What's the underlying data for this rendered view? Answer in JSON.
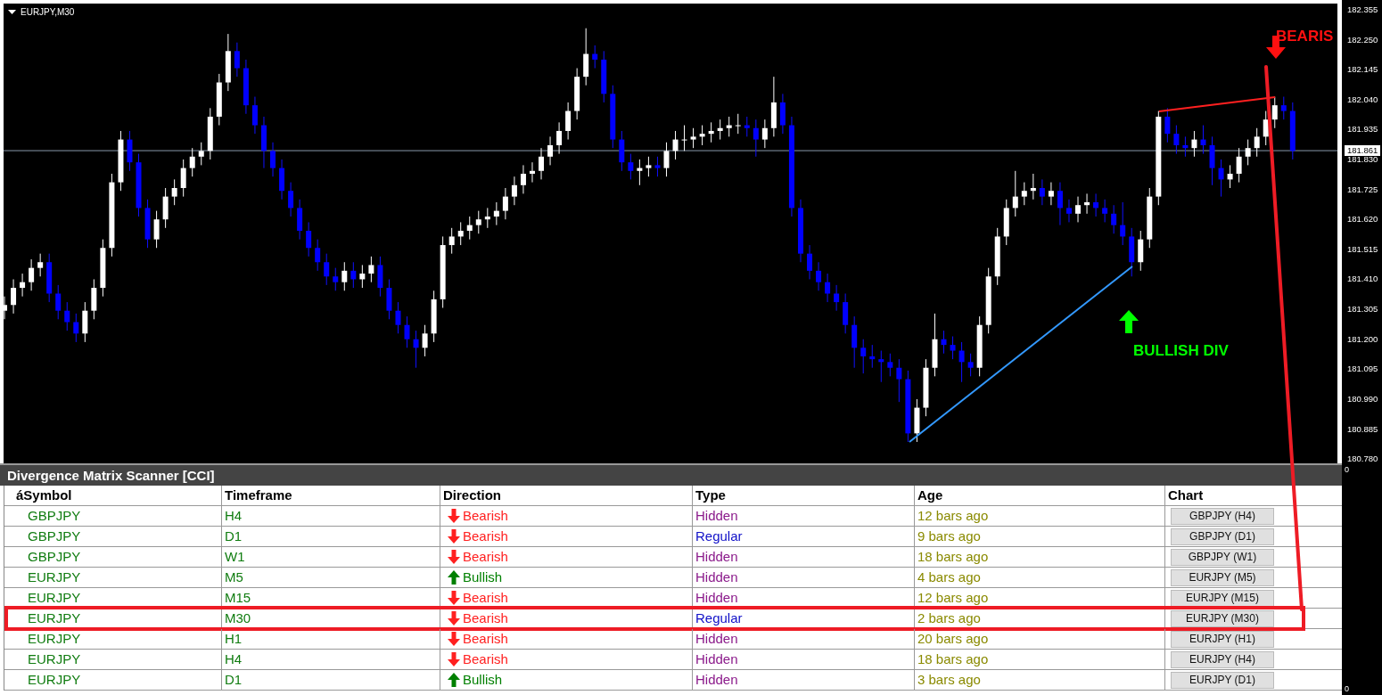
{
  "chart": {
    "title": "EURJPY,M30",
    "chart_data": {
      "type": "candlestick",
      "ylim": [
        180.765,
        182.389
      ],
      "yticks": [
        {
          "value": 182.355,
          "label": "182.355"
        },
        {
          "value": 182.25,
          "label": "182.250"
        },
        {
          "value": 182.145,
          "label": "182.145"
        },
        {
          "value": 182.04,
          "label": "182.040"
        },
        {
          "value": 181.935,
          "label": "181.935"
        },
        {
          "value": 181.83,
          "label": "181.830"
        },
        {
          "value": 181.725,
          "label": "181.725"
        },
        {
          "value": 181.62,
          "label": "181.620"
        },
        {
          "value": 181.515,
          "label": "181.515"
        },
        {
          "value": 181.41,
          "label": "181.410"
        },
        {
          "value": 181.305,
          "label": "181.305"
        },
        {
          "value": 181.2,
          "label": "181.200"
        },
        {
          "value": 181.095,
          "label": "181.095"
        },
        {
          "value": 180.99,
          "label": "180.990"
        },
        {
          "value": 180.885,
          "label": "180.885"
        },
        {
          "value": 180.78,
          "label": "180.780"
        }
      ],
      "ref_lines": [
        {
          "axis": "y",
          "value": 181.861
        }
      ],
      "categories": [
        null,
        null,
        null,
        null,
        null,
        null,
        null,
        null,
        null,
        null,
        null,
        null,
        null,
        null,
        null,
        null,
        null,
        null,
        null,
        null,
        null,
        null,
        null,
        null,
        null,
        null,
        null,
        null,
        null,
        null,
        null,
        null,
        null,
        null,
        null,
        null,
        null,
        null,
        null,
        null,
        null,
        null,
        null,
        null,
        null,
        null,
        null,
        null,
        null,
        null,
        null,
        null,
        null,
        null,
        null,
        null,
        null,
        null,
        null,
        null,
        null,
        null,
        null,
        null,
        null,
        null,
        null,
        null,
        null,
        null,
        null,
        null,
        null,
        null,
        null,
        null,
        null,
        null,
        null,
        null,
        null,
        null,
        null,
        null,
        null,
        null,
        null,
        null,
        null,
        null,
        null,
        null,
        null,
        null,
        null,
        null,
        null,
        null,
        null,
        null,
        null,
        null,
        null,
        null,
        null,
        null,
        null,
        null,
        null,
        null,
        null,
        null,
        null,
        null,
        null,
        null,
        null,
        null,
        null,
        null,
        null,
        null,
        null,
        null,
        null,
        null,
        null,
        null,
        null,
        null,
        null,
        null,
        null,
        null,
        null,
        null,
        null,
        null,
        null,
        null,
        null,
        null,
        null,
        null,
        null,
        null,
        null,
        null,
        null,
        null
      ],
      "ohlc": [
        [
          181.3,
          181.35,
          181.27,
          181.32
        ],
        [
          181.32,
          181.41,
          181.29,
          181.38
        ],
        [
          181.38,
          181.43,
          181.35,
          181.4
        ],
        [
          181.4,
          181.48,
          181.37,
          181.45
        ],
        [
          181.45,
          181.5,
          181.42,
          181.47
        ],
        [
          181.47,
          181.5,
          181.33,
          181.36
        ],
        [
          181.36,
          181.39,
          181.27,
          181.3
        ],
        [
          181.3,
          181.33,
          181.23,
          181.26
        ],
        [
          181.26,
          181.29,
          181.19,
          181.22
        ],
        [
          181.22,
          181.33,
          181.19,
          181.3
        ],
        [
          181.3,
          181.41,
          181.27,
          181.38
        ],
        [
          181.38,
          181.55,
          181.35,
          181.52
        ],
        [
          181.52,
          181.78,
          181.49,
          181.75
        ],
        [
          181.75,
          181.93,
          181.72,
          181.9
        ],
        [
          181.9,
          181.93,
          181.79,
          181.82
        ],
        [
          181.82,
          181.85,
          181.63,
          181.66
        ],
        [
          181.66,
          181.69,
          181.52,
          181.55
        ],
        [
          181.55,
          181.65,
          181.52,
          181.62
        ],
        [
          181.62,
          181.73,
          181.59,
          181.7
        ],
        [
          181.7,
          181.76,
          181.67,
          181.73
        ],
        [
          181.73,
          181.83,
          181.7,
          181.8
        ],
        [
          181.8,
          181.87,
          181.77,
          181.84
        ],
        [
          181.84,
          181.89,
          181.81,
          181.86
        ],
        [
          181.86,
          182.01,
          181.83,
          181.98
        ],
        [
          181.98,
          182.13,
          181.95,
          182.1
        ],
        [
          182.1,
          182.27,
          182.07,
          182.21
        ],
        [
          182.21,
          182.24,
          182.12,
          182.15
        ],
        [
          182.15,
          182.18,
          181.99,
          182.02
        ],
        [
          182.02,
          182.05,
          181.92,
          181.95
        ],
        [
          181.95,
          181.98,
          181.8,
          181.86
        ],
        [
          181.86,
          181.89,
          181.77,
          181.8
        ],
        [
          181.8,
          181.83,
          181.69,
          181.72
        ],
        [
          181.72,
          181.75,
          181.63,
          181.66
        ],
        [
          181.66,
          181.69,
          181.55,
          181.58
        ],
        [
          181.58,
          181.61,
          181.49,
          181.52
        ],
        [
          181.52,
          181.55,
          181.44,
          181.47
        ],
        [
          181.47,
          181.5,
          181.39,
          181.42
        ],
        [
          181.42,
          181.45,
          181.37,
          181.4
        ],
        [
          181.4,
          181.47,
          181.37,
          181.44
        ],
        [
          181.44,
          181.47,
          181.38,
          181.41
        ],
        [
          181.41,
          181.46,
          181.38,
          181.43
        ],
        [
          181.43,
          181.49,
          181.4,
          181.46
        ],
        [
          181.46,
          181.49,
          181.35,
          181.38
        ],
        [
          181.38,
          181.41,
          181.27,
          181.3
        ],
        [
          181.3,
          181.33,
          181.22,
          181.25
        ],
        [
          181.25,
          181.28,
          181.17,
          181.2
        ],
        [
          181.2,
          181.23,
          181.1,
          181.17
        ],
        [
          181.17,
          181.25,
          181.14,
          181.22
        ],
        [
          181.22,
          181.37,
          181.19,
          181.34
        ],
        [
          181.34,
          181.56,
          181.31,
          181.53
        ],
        [
          181.53,
          181.59,
          181.5,
          181.56
        ],
        [
          181.56,
          181.61,
          181.53,
          181.58
        ],
        [
          181.58,
          181.63,
          181.55,
          181.6
        ],
        [
          181.6,
          181.65,
          181.57,
          181.62
        ],
        [
          181.62,
          181.66,
          181.59,
          181.63
        ],
        [
          181.63,
          181.68,
          181.6,
          181.65
        ],
        [
          181.65,
          181.73,
          181.62,
          181.7
        ],
        [
          181.7,
          181.77,
          181.67,
          181.74
        ],
        [
          181.74,
          181.81,
          181.71,
          181.78
        ],
        [
          181.78,
          181.82,
          181.75,
          181.79
        ],
        [
          181.79,
          181.87,
          181.76,
          181.84
        ],
        [
          181.84,
          181.91,
          181.81,
          181.88
        ],
        [
          181.88,
          181.96,
          181.85,
          181.93
        ],
        [
          181.93,
          182.03,
          181.9,
          182.0
        ],
        [
          182.0,
          182.15,
          181.97,
          182.12
        ],
        [
          182.12,
          182.29,
          182.09,
          182.2
        ],
        [
          182.2,
          182.23,
          182.15,
          182.18
        ],
        [
          182.18,
          182.21,
          182.03,
          182.06
        ],
        [
          182.06,
          182.09,
          181.87,
          181.9
        ],
        [
          181.9,
          181.93,
          181.79,
          181.82
        ],
        [
          181.82,
          181.85,
          181.76,
          181.79
        ],
        [
          181.79,
          181.83,
          181.74,
          181.8
        ],
        [
          181.8,
          181.84,
          181.77,
          181.81
        ],
        [
          181.81,
          181.84,
          181.77,
          181.8
        ],
        [
          181.8,
          181.89,
          181.77,
          181.86
        ],
        [
          181.86,
          181.93,
          181.83,
          181.9
        ],
        [
          181.9,
          181.95,
          181.86,
          181.9
        ],
        [
          181.9,
          181.94,
          181.87,
          181.91
        ],
        [
          181.91,
          181.95,
          181.88,
          181.92
        ],
        [
          181.92,
          181.96,
          181.89,
          181.93
        ],
        [
          181.93,
          181.97,
          181.9,
          181.94
        ],
        [
          181.94,
          181.98,
          181.91,
          181.95
        ],
        [
          181.95,
          181.99,
          181.92,
          181.95
        ],
        [
          181.95,
          181.98,
          181.91,
          181.94
        ],
        [
          181.94,
          181.97,
          181.84,
          181.9
        ],
        [
          181.9,
          181.97,
          181.87,
          181.94
        ],
        [
          181.94,
          182.12,
          181.91,
          182.03
        ],
        [
          182.03,
          182.06,
          181.92,
          181.95
        ],
        [
          181.95,
          181.98,
          181.63,
          181.66
        ],
        [
          181.66,
          181.69,
          181.47,
          181.5
        ],
        [
          181.5,
          181.53,
          181.41,
          181.44
        ],
        [
          181.44,
          181.47,
          181.37,
          181.4
        ],
        [
          181.4,
          181.43,
          181.33,
          181.36
        ],
        [
          181.36,
          181.39,
          181.3,
          181.33
        ],
        [
          181.33,
          181.36,
          181.22,
          181.25
        ],
        [
          181.25,
          181.28,
          181.1,
          181.17
        ],
        [
          181.17,
          181.2,
          181.08,
          181.14
        ],
        [
          181.14,
          181.18,
          181.1,
          181.13
        ],
        [
          181.13,
          181.16,
          181.05,
          181.12
        ],
        [
          181.12,
          181.15,
          181.07,
          181.1
        ],
        [
          181.1,
          181.13,
          180.98,
          181.06
        ],
        [
          181.06,
          181.09,
          180.84,
          180.87
        ],
        [
          180.87,
          180.99,
          180.84,
          180.96
        ],
        [
          180.96,
          181.13,
          180.93,
          181.1
        ],
        [
          181.1,
          181.29,
          181.07,
          181.2
        ],
        [
          181.2,
          181.23,
          181.15,
          181.18
        ],
        [
          181.18,
          181.21,
          181.13,
          181.16
        ],
        [
          181.16,
          181.19,
          181.05,
          181.12
        ],
        [
          181.12,
          181.15,
          181.07,
          181.1
        ],
        [
          181.1,
          181.28,
          181.07,
          181.25
        ],
        [
          181.25,
          181.45,
          181.22,
          181.42
        ],
        [
          181.42,
          181.59,
          181.39,
          181.56
        ],
        [
          181.56,
          181.69,
          181.53,
          181.66
        ],
        [
          181.66,
          181.79,
          181.63,
          181.7
        ],
        [
          181.7,
          181.75,
          181.67,
          181.72
        ],
        [
          181.72,
          181.78,
          181.69,
          181.73
        ],
        [
          181.73,
          181.76,
          181.67,
          181.7
        ],
        [
          181.7,
          181.75,
          181.67,
          181.72
        ],
        [
          181.72,
          181.75,
          181.6,
          181.66
        ],
        [
          181.66,
          181.69,
          181.61,
          181.64
        ],
        [
          181.64,
          181.7,
          181.61,
          181.67
        ],
        [
          181.67,
          181.71,
          181.64,
          181.68
        ],
        [
          181.68,
          181.71,
          181.63,
          181.66
        ],
        [
          181.66,
          181.69,
          181.61,
          181.64
        ],
        [
          181.64,
          181.67,
          181.57,
          181.6
        ],
        [
          181.6,
          181.68,
          181.53,
          181.56
        ],
        [
          181.56,
          181.59,
          181.42,
          181.47
        ],
        [
          181.47,
          181.58,
          181.44,
          181.55
        ],
        [
          181.55,
          181.73,
          181.52,
          181.7
        ],
        [
          181.7,
          182.0,
          181.67,
          181.98
        ],
        [
          181.98,
          182.01,
          181.89,
          181.92
        ],
        [
          181.92,
          181.95,
          181.85,
          181.88
        ],
        [
          181.88,
          181.91,
          181.84,
          181.87
        ],
        [
          181.87,
          181.93,
          181.84,
          181.9
        ],
        [
          181.9,
          181.95,
          181.85,
          181.88
        ],
        [
          181.88,
          181.91,
          181.74,
          181.8
        ],
        [
          181.8,
          181.83,
          181.7,
          181.76
        ],
        [
          181.76,
          181.81,
          181.73,
          181.78
        ],
        [
          181.78,
          181.87,
          181.75,
          181.84
        ],
        [
          181.84,
          181.9,
          181.81,
          181.87
        ],
        [
          181.87,
          181.94,
          181.84,
          181.91
        ],
        [
          181.91,
          182.0,
          181.88,
          181.97
        ],
        [
          181.97,
          182.05,
          181.94,
          182.02
        ],
        [
          182.02,
          182.05,
          181.97,
          182.0
        ],
        [
          182.0,
          182.03,
          181.83,
          181.86
        ],
        null,
        null,
        null,
        null,
        null
      ]
    },
    "current_price": "181.861",
    "annotations": [
      {
        "kind": "bullish",
        "label": "BULLISH DIV"
      },
      {
        "kind": "bearish",
        "label": "BEARIS"
      }
    ]
  },
  "scanner": {
    "title": "Divergence Matrix Scanner [CCI]",
    "columns": [
      "áSymbol",
      "Timeframe",
      "Direction",
      "Type",
      "Age",
      "Chart"
    ],
    "rows": [
      {
        "symbol": "GBPJPY",
        "timeframe": "H4",
        "direction": {
          "kind": "bearish",
          "label": "Bearish"
        },
        "type": {
          "kind": "hidden",
          "label": "Hidden"
        },
        "age": "12 bars ago",
        "chart_button": "GBPJPY (H4)",
        "outlined": false
      },
      {
        "symbol": "GBPJPY",
        "timeframe": "D1",
        "direction": {
          "kind": "bearish",
          "label": "Bearish"
        },
        "type": {
          "kind": "regular",
          "label": "Regular"
        },
        "age": "9 bars ago",
        "chart_button": "GBPJPY (D1)",
        "outlined": false
      },
      {
        "symbol": "GBPJPY",
        "timeframe": "W1",
        "direction": {
          "kind": "bearish",
          "label": "Bearish"
        },
        "type": {
          "kind": "hidden",
          "label": "Hidden"
        },
        "age": "18 bars ago",
        "chart_button": "GBPJPY (W1)",
        "outlined": false
      },
      {
        "symbol": "EURJPY",
        "timeframe": "M5",
        "direction": {
          "kind": "bullish",
          "label": "Bullish"
        },
        "type": {
          "kind": "hidden",
          "label": "Hidden"
        },
        "age": "4 bars ago",
        "chart_button": "EURJPY (M5)",
        "outlined": false
      },
      {
        "symbol": "EURJPY",
        "timeframe": "M15",
        "direction": {
          "kind": "bearish",
          "label": "Bearish"
        },
        "type": {
          "kind": "hidden",
          "label": "Hidden"
        },
        "age": "12 bars ago",
        "chart_button": "EURJPY (M15)",
        "outlined": false
      },
      {
        "symbol": "EURJPY",
        "timeframe": "M30",
        "direction": {
          "kind": "bearish",
          "label": "Bearish"
        },
        "type": {
          "kind": "regular",
          "label": "Regular"
        },
        "age": "2 bars ago",
        "chart_button": "EURJPY (M30)",
        "outlined": true
      },
      {
        "symbol": "EURJPY",
        "timeframe": "H1",
        "direction": {
          "kind": "bearish",
          "label": "Bearish"
        },
        "type": {
          "kind": "hidden",
          "label": "Hidden"
        },
        "age": "20 bars ago",
        "chart_button": "EURJPY (H1)",
        "outlined": false
      },
      {
        "symbol": "EURJPY",
        "timeframe": "H4",
        "direction": {
          "kind": "bearish",
          "label": "Bearish"
        },
        "type": {
          "kind": "hidden",
          "label": "Hidden"
        },
        "age": "18 bars ago",
        "chart_button": "EURJPY (H4)",
        "outlined": false
      },
      {
        "symbol": "EURJPY",
        "timeframe": "D1",
        "direction": {
          "kind": "bullish",
          "label": "Bullish"
        },
        "type": {
          "kind": "hidden",
          "label": "Hidden"
        },
        "age": "3 bars ago",
        "chart_button": "EURJPY (D1)",
        "outlined": false
      }
    ]
  },
  "sub_axis": [
    "0",
    "0"
  ]
}
